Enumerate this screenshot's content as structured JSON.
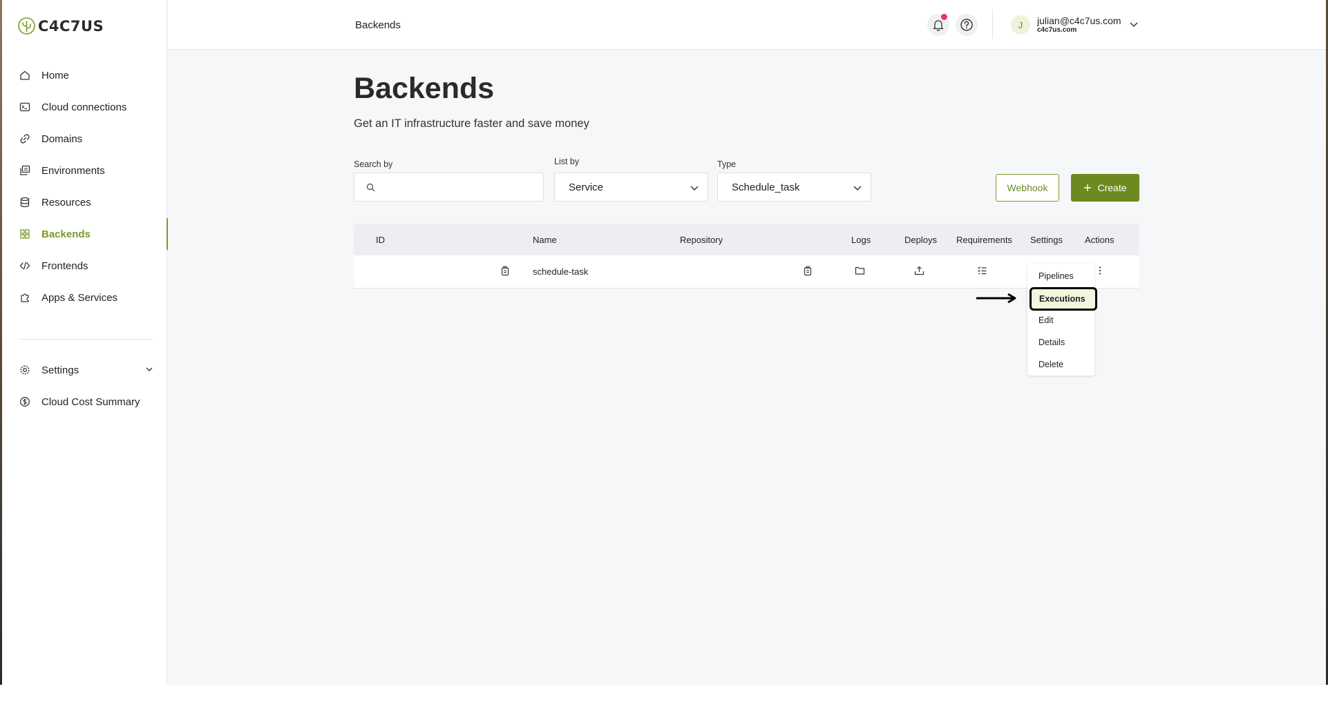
{
  "brand": {
    "name": "C4C7US"
  },
  "sidebar": {
    "items": [
      {
        "label": "Home",
        "icon": "home-icon"
      },
      {
        "label": "Cloud connections",
        "icon": "terminal-icon"
      },
      {
        "label": "Domains",
        "icon": "link-icon"
      },
      {
        "label": "Environments",
        "icon": "environments-icon"
      },
      {
        "label": "Resources",
        "icon": "database-icon"
      },
      {
        "label": "Backends",
        "icon": "grid-icon",
        "active": true
      },
      {
        "label": "Frontends",
        "icon": "code-icon"
      },
      {
        "label": "Apps & Services",
        "icon": "puzzle-icon"
      }
    ],
    "secondary": [
      {
        "label": "Settings",
        "icon": "gear-icon"
      },
      {
        "label": "Cloud Cost Summary",
        "icon": "dollar-icon"
      }
    ]
  },
  "header": {
    "breadcrumb": "Backends",
    "user": {
      "initial": "J",
      "email": "julian@c4c7us.com",
      "org": "c4c7us.com"
    }
  },
  "main": {
    "title": "Backends",
    "subtitle": "Get an IT infrastructure faster and save money",
    "filters": {
      "search_label": "Search by",
      "search_value": "",
      "list_label": "List by",
      "list_value": "Service",
      "type_label": "Type",
      "type_value": "Schedule_task"
    },
    "buttons": {
      "webhook": "Webhook",
      "create": "Create"
    },
    "table": {
      "headers": [
        "ID",
        "Name",
        "Repository",
        "Logs",
        "Deploys",
        "Requirements",
        "Settings",
        "Actions"
      ],
      "rows": [
        {
          "id": "",
          "name": "schedule-task",
          "repository": ""
        }
      ]
    },
    "actions_menu": [
      "Pipelines",
      "Executions",
      "Edit",
      "Details",
      "Delete"
    ]
  },
  "colors": {
    "accent": "#6d8a20",
    "notification": "#e8355a",
    "highlight": "#f1f6dd"
  }
}
